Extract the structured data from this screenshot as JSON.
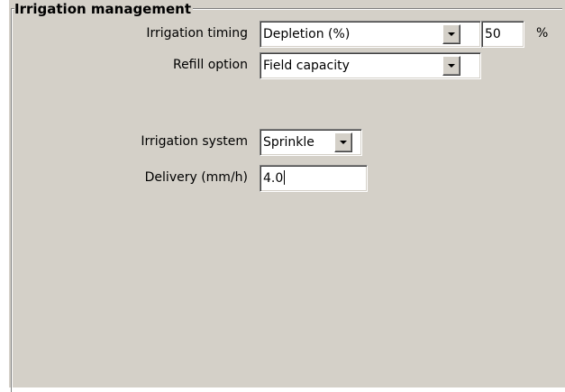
{
  "group": {
    "title": "Irrigation management"
  },
  "rows": {
    "timing": {
      "label": "Irrigation timing",
      "value": "Depletion (%)",
      "percent_value": "50",
      "percent_unit": "%"
    },
    "refill": {
      "label": "Refill option",
      "value": "Field capacity"
    },
    "system": {
      "label": "Irrigation system",
      "value": "Sprinkle"
    },
    "delivery": {
      "label": "Delivery (mm/h)",
      "value": "4.0"
    }
  },
  "icons": {
    "dropdown": "chevron-down-icon"
  },
  "colors": {
    "panel_bg": "#d4d0c8",
    "field_bg": "#ffffff"
  }
}
